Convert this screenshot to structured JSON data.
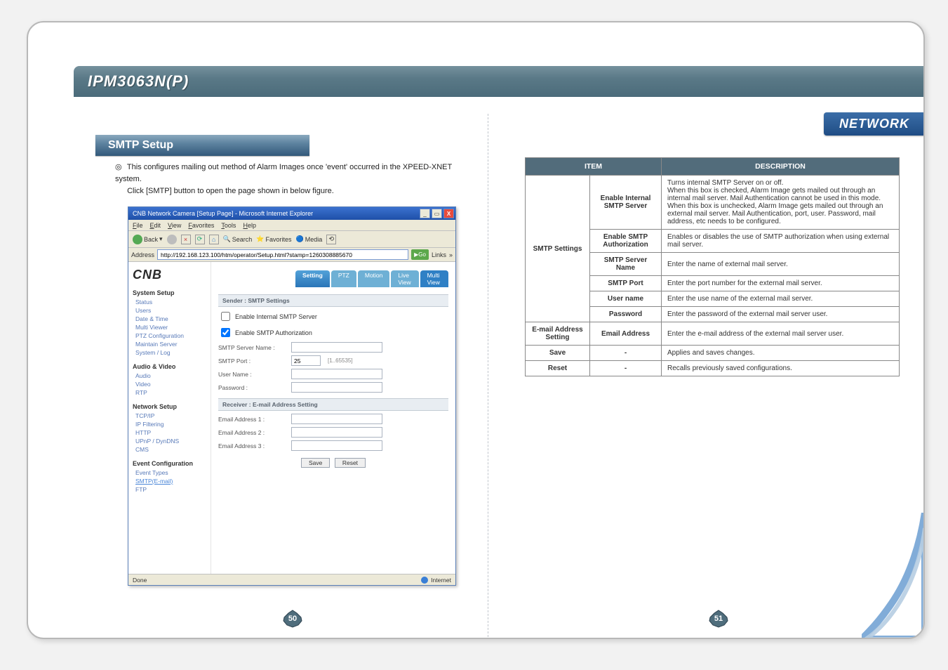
{
  "header": {
    "model": "IPM3063N(P)"
  },
  "section_tag": "NETWORK",
  "section_title": "SMTP Setup",
  "intro": {
    "bullet": "◎",
    "line1": "This configures mailing out method of Alarm Images once 'event' occurred in the XPEED-XNET system.",
    "line2": "Click [SMTP] button to open the page shown in below figure."
  },
  "ie": {
    "title": "CNB Network Camera [Setup Page] - Microsoft Internet Explorer",
    "menu": {
      "file": "File",
      "edit": "Edit",
      "view": "View",
      "favorites": "Favorites",
      "tools": "Tools",
      "help": "Help"
    },
    "tools": {
      "back": "Back",
      "search": "Search",
      "fav": "Favorites",
      "media": "Media"
    },
    "addr_label": "Address",
    "url": "http://192.168.123.100/htm/operator/Setup.html?stamp=1260308885670",
    "go": "Go",
    "links": "Links",
    "status_done": "Done",
    "status_zone": "Internet"
  },
  "cnb": {
    "logo": "CNB",
    "tabs": {
      "setting": "Setting",
      "ptz": "PTZ",
      "motion": "Motion",
      "live": "Live View",
      "multi": "Multi View"
    },
    "nav": {
      "system": {
        "title": "System Setup",
        "items": {
          "status": "Status",
          "users": "Users",
          "date": "Date & Time",
          "mv": "Multi Viewer",
          "ptz": "PTZ Configuration",
          "maint": "Maintain Server",
          "syslog": "System / Log"
        }
      },
      "av": {
        "title": "Audio & Video",
        "items": {
          "audio": "Audio",
          "video": "Video",
          "rtp": "RTP"
        }
      },
      "net": {
        "title": "Network Setup",
        "items": {
          "tcpip": "TCP/IP",
          "ipf": "IP Filtering",
          "http": "HTTP",
          "upnp": "UPnP / DynDNS",
          "cms": "CMS"
        }
      },
      "event": {
        "title": "Event Configuration",
        "items": {
          "types": "Event Types",
          "smtp": "SMTP(E-mail)",
          "ftp": "FTP"
        }
      }
    },
    "sender_head": "Sender : SMTP Settings",
    "chk_internal": "Enable Internal SMTP Server",
    "chk_auth": "Enable SMTP Authorization",
    "lbl_server": "SMTP Server Name :",
    "lbl_port": "SMTP Port :",
    "port_value": "25",
    "port_hint": "[1..65535]",
    "lbl_user": "User Name :",
    "lbl_pass": "Password :",
    "recv_head": "Receiver : E-mail Address Setting",
    "lbl_e1": "Email Address 1 :",
    "lbl_e2": "Email Address 2 :",
    "lbl_e3": "Email Address 3 :",
    "btn_save": "Save",
    "btn_reset": "Reset"
  },
  "table": {
    "head_item": "ITEM",
    "head_desc": "DESCRIPTION",
    "rows": {
      "smtp_group": "SMTP Settings",
      "r1_sub": "Enable Internal SMTP Server",
      "r1_desc": "Turns internal SMTP Server on or off.\nWhen this box is checked, Alarm Image gets mailed out through an internal mail server. Mail Authentication cannot be used in this mode.\nWhen this box is unchecked, Alarm Image gets mailed out through an external mail server. Mail Authentication, port, user. Password, mail address, etc needs to be configured.",
      "r2_sub": "Enable SMTP Authorization",
      "r2_desc": "Enables or disables the use of SMTP authorization when using external mail server.",
      "r3_sub": "SMTP Server Name",
      "r3_desc": "Enter the name of external mail server.",
      "r4_sub": "SMTP Port",
      "r4_desc": "Enter the port number for the external mail server.",
      "r5_sub": "User name",
      "r5_desc": "Enter the use name of the external mail server.",
      "r6_sub": "Password",
      "r6_desc": "Enter the password of the external mail server user.",
      "email_group": "E-mail Address Setting",
      "r7_sub": "Email Address",
      "r7_desc": "Enter the e-mail address of the external mail server user.",
      "r8_item": "Save",
      "r8_sub": "-",
      "r8_desc": "Applies and saves changes.",
      "r9_item": "Reset",
      "r9_sub": "-",
      "r9_desc": "Recalls previously saved configurations."
    }
  },
  "pagenum_left": "50",
  "pagenum_right": "51"
}
